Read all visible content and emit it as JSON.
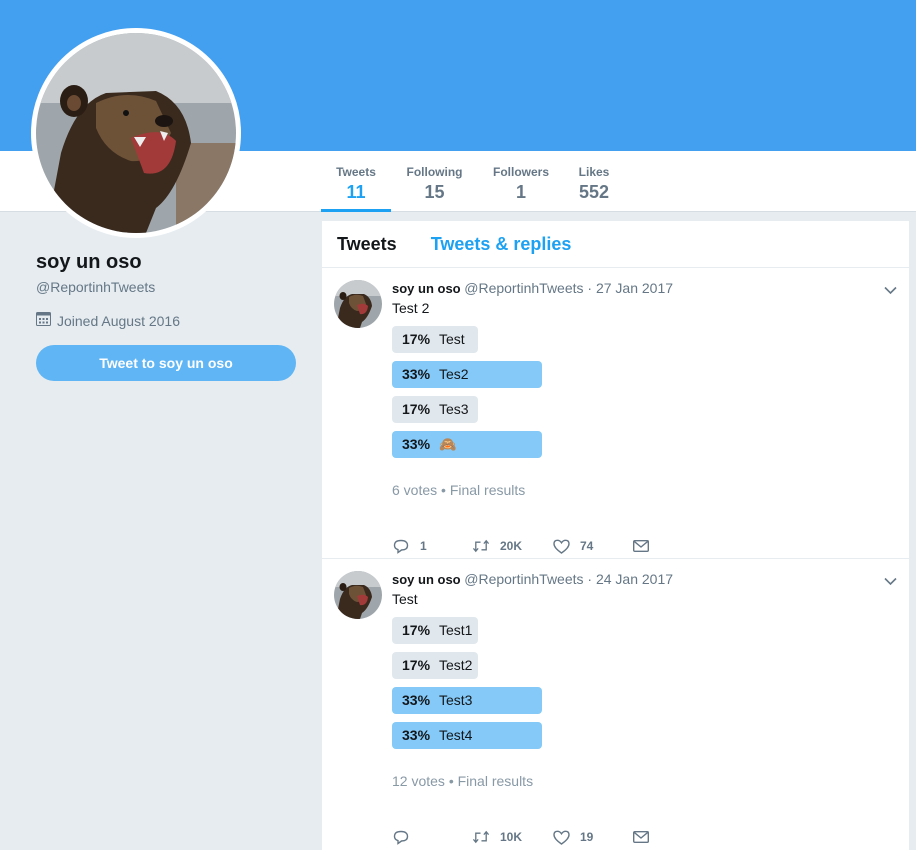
{
  "colors": {
    "banner": "#43a0f0",
    "accent": "#1da1f2",
    "leader_bar": "#84c9f7",
    "other_bar": "#e1e8ed"
  },
  "profile": {
    "name": "soy un oso",
    "handle": "@ReportinhTweets",
    "joined": "Joined August 2016",
    "tweet_to_label": "Tweet to soy un oso"
  },
  "stats": [
    {
      "label": "Tweets",
      "value": "11"
    },
    {
      "label": "Following",
      "value": "15"
    },
    {
      "label": "Followers",
      "value": "1"
    },
    {
      "label": "Likes",
      "value": "552"
    }
  ],
  "timeline_tabs": [
    "Tweets",
    "Tweets & replies"
  ],
  "tweets": [
    {
      "name": "soy un oso",
      "meta": "@ReportinhTweets · 27 Jan 2017",
      "text": "Test 2",
      "poll": [
        {
          "pct": "17%",
          "label": "Test",
          "share": 0.17,
          "leader": false
        },
        {
          "pct": "33%",
          "label": "Tes2",
          "share": 0.33,
          "leader": true
        },
        {
          "pct": "17%",
          "label": "Tes3",
          "share": 0.17,
          "leader": false
        },
        {
          "pct": "33%",
          "label": "🙈",
          "share": 0.33,
          "leader": true
        }
      ],
      "poll_meta": "6 votes • Final results",
      "actions": {
        "reply": "1",
        "retweet": "20K",
        "like": "74",
        "message": ""
      }
    },
    {
      "name": "soy un oso",
      "meta": "@ReportinhTweets · 24 Jan 2017",
      "text": "Test",
      "poll": [
        {
          "pct": "17%",
          "label": "Test1",
          "share": 0.17,
          "leader": false
        },
        {
          "pct": "17%",
          "label": "Test2",
          "share": 0.17,
          "leader": false
        },
        {
          "pct": "33%",
          "label": "Test3",
          "share": 0.33,
          "leader": true
        },
        {
          "pct": "33%",
          "label": "Test4",
          "share": 0.33,
          "leader": true
        }
      ],
      "poll_meta": "12 votes • Final results",
      "actions": {
        "reply": "",
        "retweet": "10K",
        "like": "19",
        "message": ""
      }
    }
  ]
}
